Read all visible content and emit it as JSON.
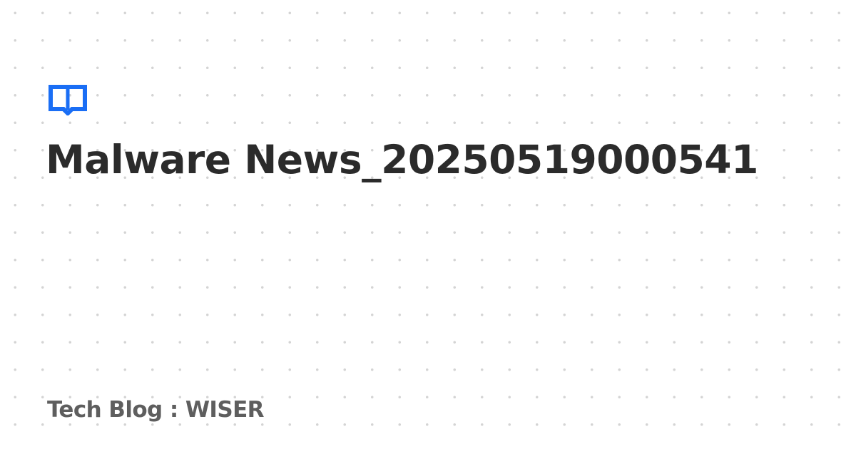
{
  "post": {
    "title": "Malware News_20250519000541",
    "blog_label": "Tech Blog : WISER"
  },
  "logo": {
    "icon": "open-book-icon",
    "color": "#1a6ef5"
  },
  "colors": {
    "title": "#2b2b2b",
    "footer": "#5e5e5e",
    "background": "#ffffff",
    "dots": "#d4d4d4"
  }
}
